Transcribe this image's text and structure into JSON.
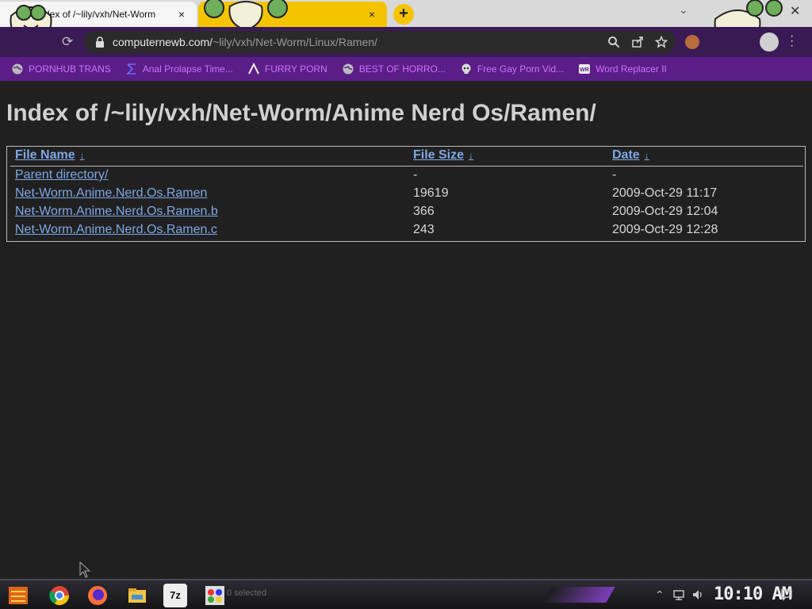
{
  "browser": {
    "tabs": [
      {
        "title": "Index of /~lily/vxh/Net-Worm",
        "active": true
      },
      {
        "title": "",
        "active": false
      }
    ],
    "new_tab_symbol": "+",
    "tab_close_symbol": "×",
    "url_domain": "computernewb.com/",
    "url_path": "~lily/vxh/Net-Worm/Linux/Ramen/"
  },
  "bookmarks": [
    {
      "label": "PORNHUB TRANS",
      "icon": "globe-icon"
    },
    {
      "label": "Anal Prolapse Time...",
      "icon": "sigma-icon"
    },
    {
      "label": "FURRY PORN",
      "icon": "lambda-icon"
    },
    {
      "label": "BEST OF HORRO...",
      "icon": "globe-icon"
    },
    {
      "label": "Free Gay Porn Vid...",
      "icon": "skull-icon"
    },
    {
      "label": "Word Replacer II",
      "icon": "wr-icon"
    }
  ],
  "page": {
    "heading": "Index of /~lily/vxh/Net-Worm/Anime Nerd Os/Ramen/",
    "columns": [
      "File Name",
      "File Size",
      "Date"
    ],
    "sort_arrow": "↓",
    "rows": [
      {
        "name": "Parent directory/",
        "size": "-",
        "date": "-"
      },
      {
        "name": "Net-Worm.Anime.Nerd.Os.Ramen",
        "size": "19619",
        "date": "2009-Oct-29 11:17"
      },
      {
        "name": "Net-Worm.Anime.Nerd.Os.Ramen.b",
        "size": "366",
        "date": "2009-Oct-29 12:04"
      },
      {
        "name": "Net-Worm.Anime.Nerd.Os.Ramen.c",
        "size": "243",
        "date": "2009-Oct-29 12:28"
      }
    ]
  },
  "taskbar": {
    "status_text": "0 selected",
    "clock": "10:10 AM",
    "apps": [
      "start-icon",
      "chrome-icon",
      "firefox-icon",
      "file-explorer-icon",
      "7zip-icon",
      "paint-icon"
    ],
    "sevenzip_label": "7z"
  },
  "colors": {
    "toolbar": "#3a1a55",
    "bookmarks_bar": "#5a1e86",
    "bookmark_text": "#d070ff",
    "link": "#7fa8e6",
    "page_bg": "#202020"
  }
}
